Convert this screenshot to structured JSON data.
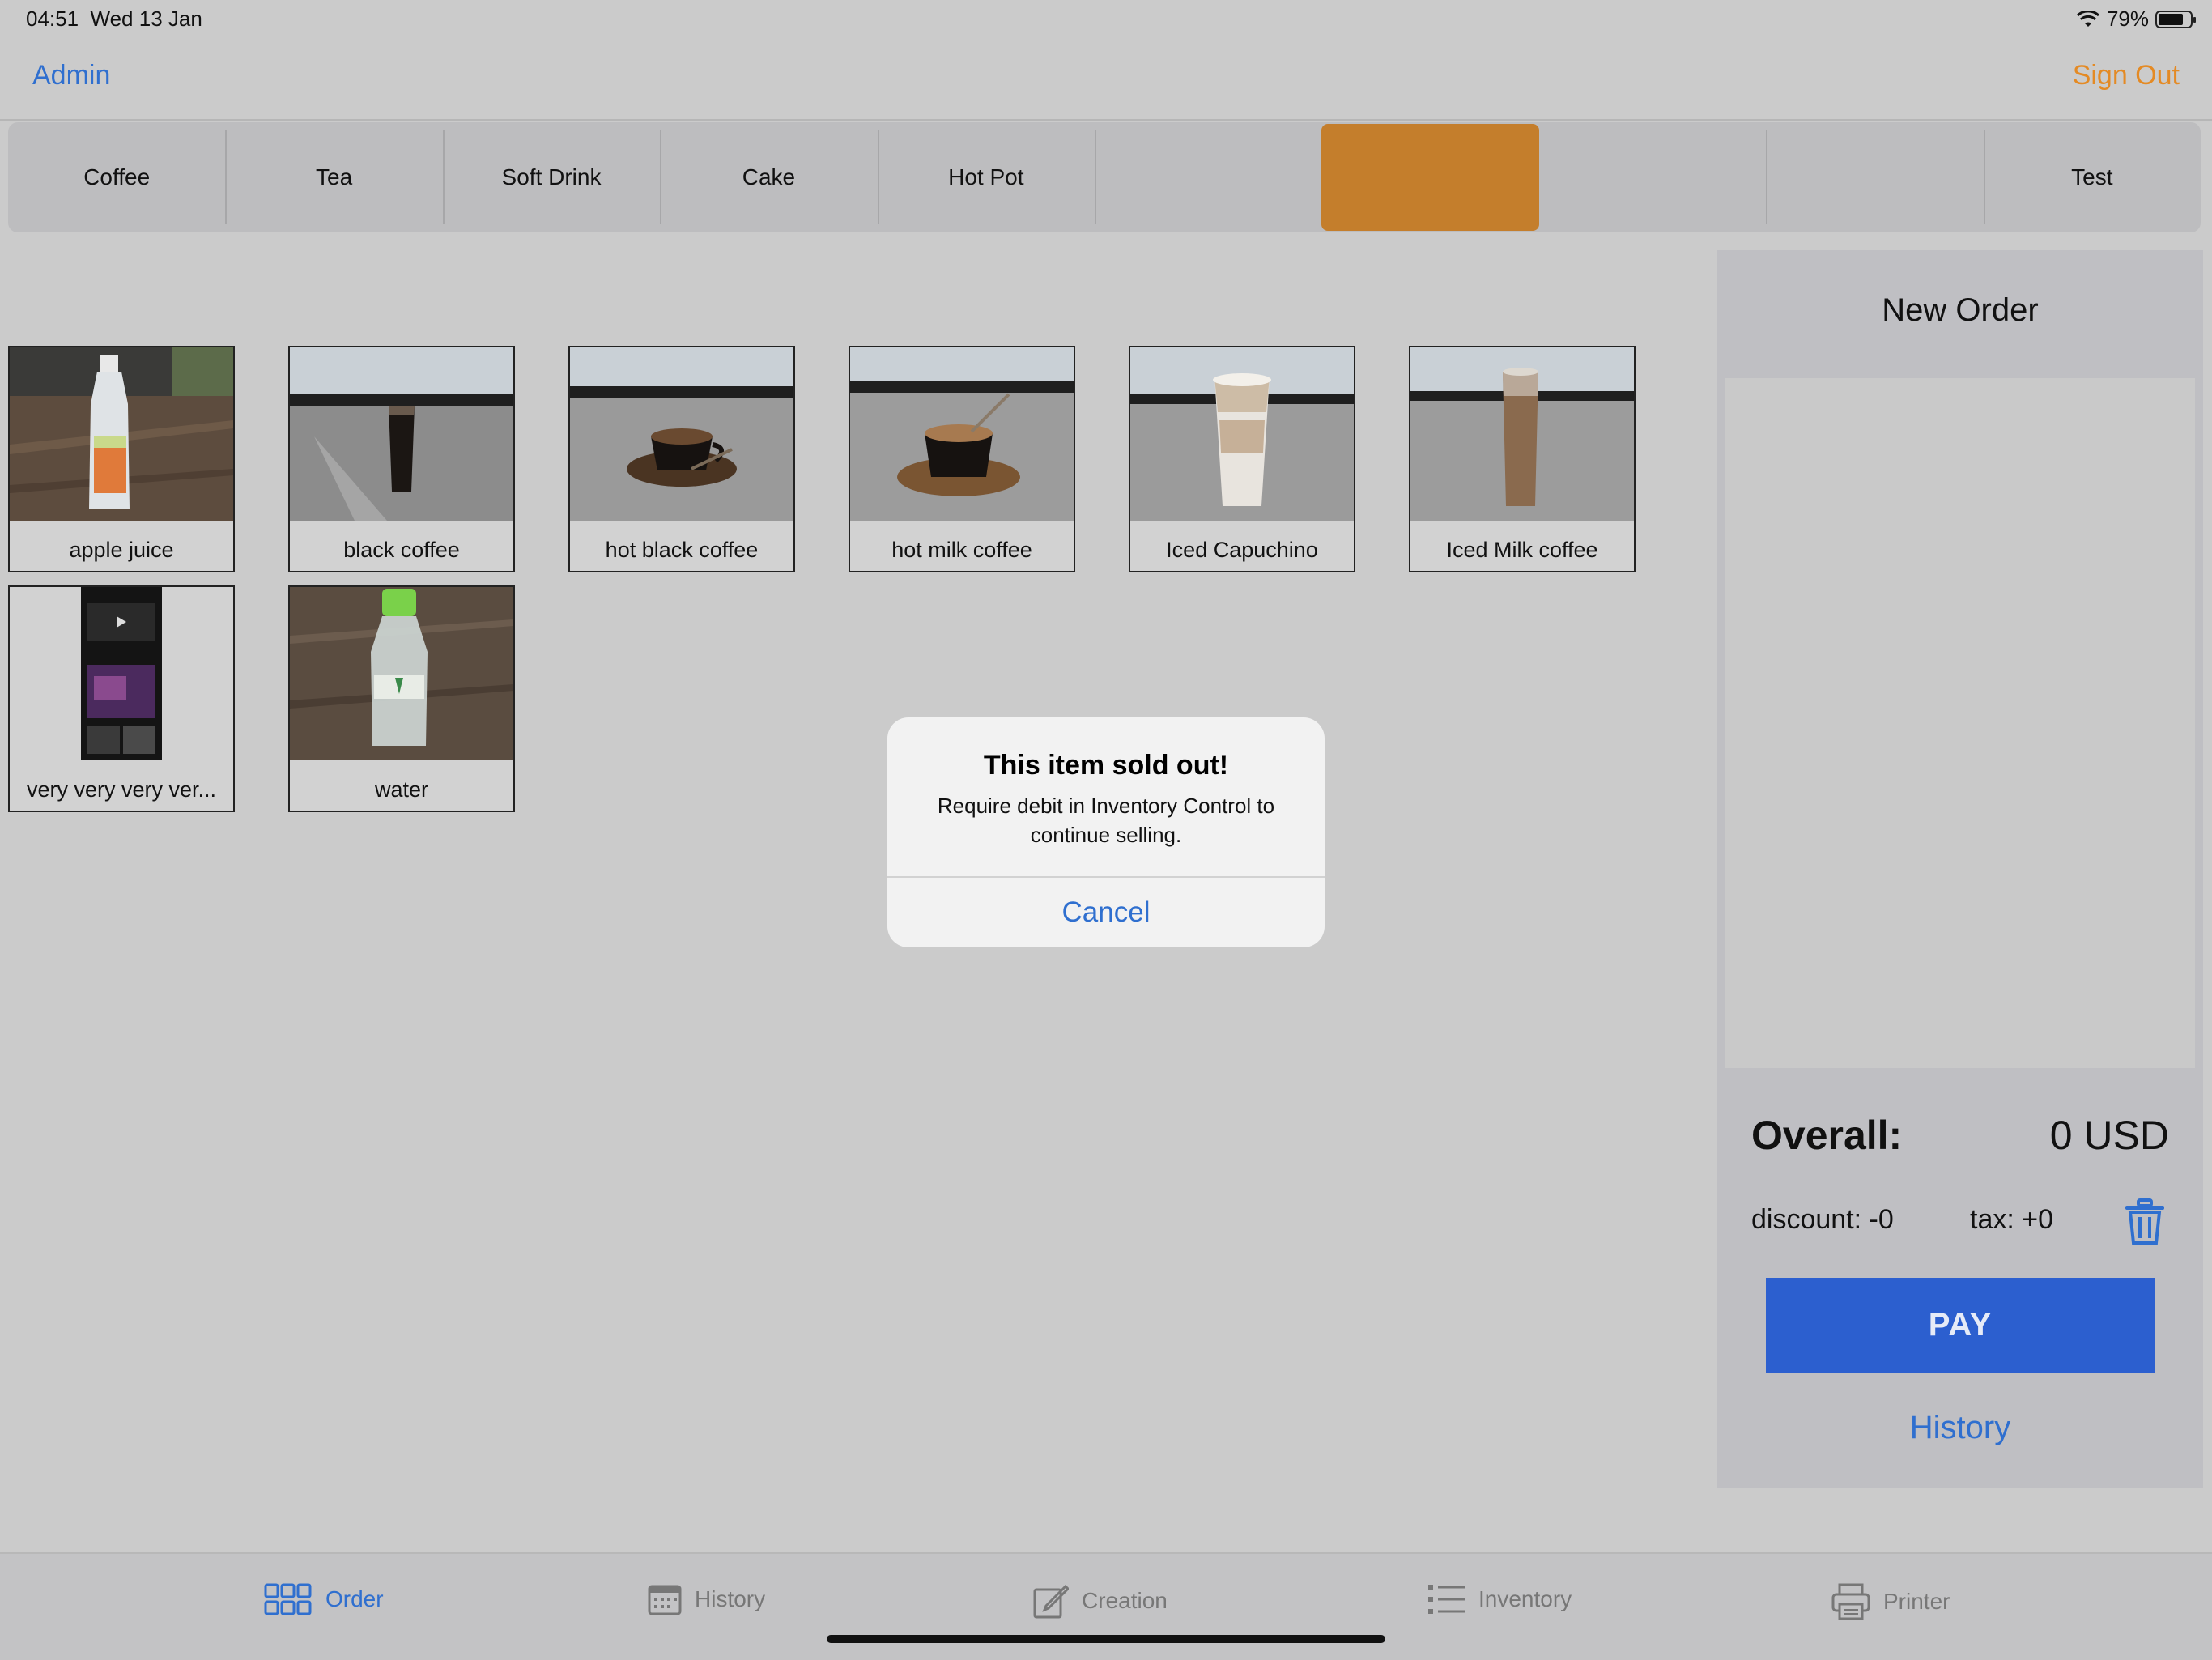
{
  "status_bar": {
    "time": "04:51",
    "date": "Wed 13 Jan",
    "battery": "79%",
    "battery_level": 0.79
  },
  "nav": {
    "admin": "Admin",
    "sign_out": "Sign Out"
  },
  "categories": [
    {
      "label": "Coffee"
    },
    {
      "label": "Tea"
    },
    {
      "label": "Soft Drink"
    },
    {
      "label": "Cake"
    },
    {
      "label": "Hot Pot"
    },
    {
      "label": ""
    },
    {
      "label": ""
    },
    {
      "label": ""
    },
    {
      "label": ""
    },
    {
      "label": "Test"
    }
  ],
  "products": [
    {
      "label": "apple juice"
    },
    {
      "label": "black coffee"
    },
    {
      "label": "hot black coffee"
    },
    {
      "label": "hot milk coffee"
    },
    {
      "label": "Iced Capuchino"
    },
    {
      "label": "Iced Milk coffee"
    },
    {
      "label": "very very very ver..."
    },
    {
      "label": "water"
    }
  ],
  "order": {
    "title": "New Order",
    "overall_label": "Overall:",
    "overall_value": "0 USD",
    "discount": "discount: -0",
    "tax": "tax: +0",
    "pay": "PAY",
    "history": "History"
  },
  "alert": {
    "title": "This item sold out!",
    "message": "Require debit in Inventory Control to continue selling.",
    "cancel": "Cancel"
  },
  "tabs": [
    {
      "label": "Order",
      "icon": "grid-icon"
    },
    {
      "label": "History",
      "icon": "calendar-icon"
    },
    {
      "label": "Creation",
      "icon": "edit-icon"
    },
    {
      "label": "Inventory",
      "icon": "list-icon"
    },
    {
      "label": "Printer",
      "icon": "printer-icon"
    }
  ],
  "colors": {
    "accent_blue": "#2f6fcf",
    "accent_orange": "#c47e2c",
    "pay_button": "#2c5fcf"
  }
}
